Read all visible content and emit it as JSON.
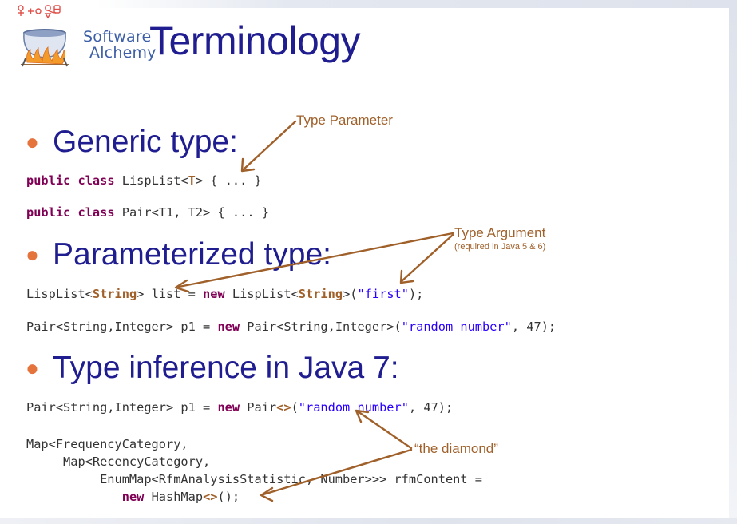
{
  "logo": {
    "line1": "Software",
    "line2": "Alchemy"
  },
  "title": "Terminology",
  "bullets": {
    "generic": "Generic type:",
    "parameterized": "Parameterized type:",
    "inference": "Type inference in Java 7:"
  },
  "code": {
    "line1": [
      "public",
      " ",
      "class",
      " LispList<",
      "T",
      "> { ... }"
    ],
    "line2": [
      "public",
      " ",
      "class",
      " Pair<T1, T2> { ... }"
    ],
    "line3": [
      "LispList<",
      "String",
      "> list = ",
      "new",
      " LispList<",
      "String",
      ">(",
      "\"first\"",
      ");"
    ],
    "line4": [
      "Pair<String,Integer> p1 = ",
      "new",
      " Pair<String,Integer>(",
      "\"random number\"",
      ", 47);"
    ],
    "line5": [
      "Pair<String,Integer> p1 = ",
      "new",
      " Pair",
      "<>",
      "(",
      "\"random number\"",
      ", 47);"
    ],
    "line6": "Map<FrequencyCategory,",
    "line7": "     Map<RecencyCategory,",
    "line8": "          EnumMap<RfmAnalysisStatistic, Number>>> rfmContent =",
    "line9": [
      "             ",
      "new",
      " HashMap",
      "<>",
      "();"
    ]
  },
  "annotations": {
    "type_parameter": "Type Parameter",
    "type_argument": "Type Argument",
    "type_argument_sub": "(required in Java 5 & 6)",
    "diamond": "“the diamond”"
  },
  "colors": {
    "title": "#1f1d8f",
    "bullet_dot": "#e4733c",
    "keyword": "#7f0055",
    "string": "#2a00ff",
    "annotation": "#a0602a",
    "code": "#333333"
  },
  "icons": [
    "cauldron-icon",
    "alchemy-symbols-icon",
    "arrow-icon"
  ]
}
